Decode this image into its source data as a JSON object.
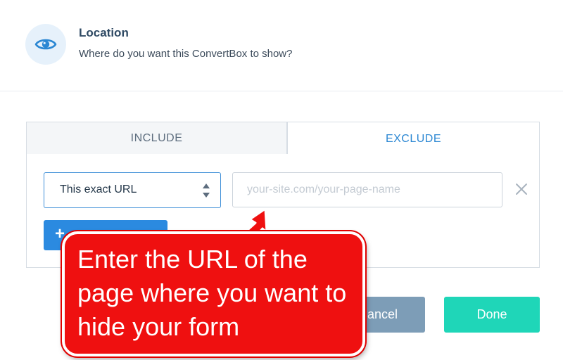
{
  "header": {
    "title": "Location",
    "subtitle": "Where do you want this ConvertBox to show?",
    "icon": "eye-icon"
  },
  "tabs": [
    {
      "label": "INCLUDE",
      "active": false
    },
    {
      "label": "EXCLUDE",
      "active": true
    }
  ],
  "rule": {
    "match_type": "This exact URL",
    "url_value": "",
    "url_placeholder": "your-site.com/your-page-name"
  },
  "add_button": {
    "label": "+"
  },
  "footer": {
    "cancel_label": "Cancel",
    "done_label": "Done"
  },
  "annotation": {
    "text": "Enter the URL of the page where you want to hide your form"
  },
  "colors": {
    "accent": "#2b8ae0",
    "done": "#1fd6b8",
    "cancel": "#7d9db7",
    "callout": "#ef1010"
  }
}
